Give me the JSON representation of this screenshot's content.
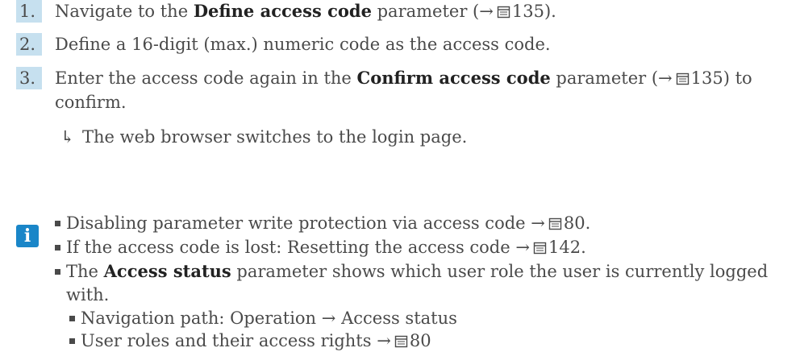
{
  "steps": [
    {
      "num": "1.",
      "pre": "Navigate to the ",
      "bold": "Define access code",
      "post": " parameter (",
      "arrow": "→",
      "page": "135",
      "end": ")."
    },
    {
      "num": "2.",
      "text": "Define a 16-digit (max.) numeric code as the access code."
    },
    {
      "num": "3.",
      "pre": "Enter the access code again in the ",
      "bold": "Confirm access code",
      "post": " parameter (",
      "arrow": "→",
      "page": "135",
      "end": ") to",
      "line2": "confirm."
    }
  ],
  "result": {
    "arrow": "↳",
    "text": "The web browser switches to the login page."
  },
  "info": {
    "icon_letter": "i",
    "items": [
      {
        "text": "Disabling parameter write protection via access code",
        "arrow": "→",
        "page": "80."
      },
      {
        "text": "If the access code is lost: Resetting the access code",
        "arrow": "→",
        "page": "142."
      },
      {
        "pre": "The ",
        "bold": "Access status",
        "post": " parameter shows which user role the user is currently logged",
        "line2": "with."
      }
    ],
    "subitems": [
      {
        "text": "Navigation path: Operation",
        "arrow": "→",
        "text2": "Access status"
      },
      {
        "text": "User roles and their access rights",
        "arrow": "→",
        "page": "80"
      }
    ]
  },
  "colors": {
    "number_bg": "#c6e0ef",
    "info_icon": "#1a86c8",
    "text": "#4a4a4a"
  }
}
